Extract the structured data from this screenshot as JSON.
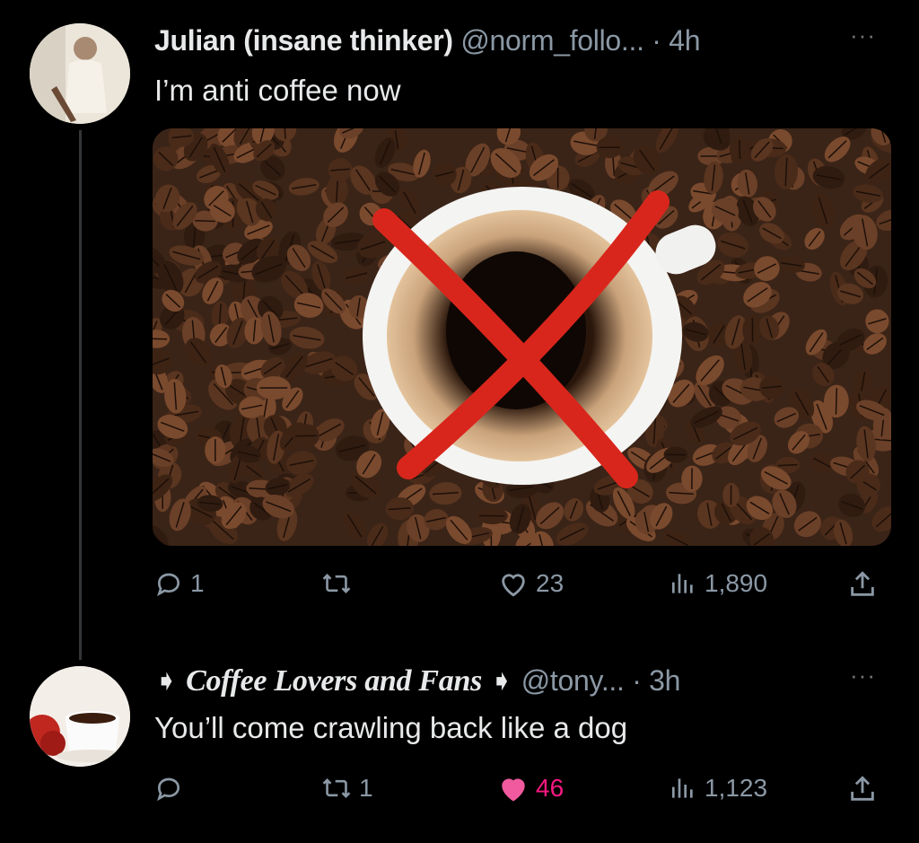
{
  "tweets": [
    {
      "name": "Julian (insane thinker)",
      "handle": "@norm_follo...",
      "separator": " · ",
      "time": "4h",
      "more": "···",
      "text": "I’m anti coffee now",
      "stats": {
        "replies": "1",
        "retweets": "",
        "likes": "23",
        "views": "1,890"
      }
    },
    {
      "name": "Coffee Lovers and Fans",
      "name_prefix": "➧ ",
      "name_suffix": " ➧",
      "handle": "@tony...",
      "separator": " · ",
      "time": "3h",
      "more": "···",
      "text": "You’ll come crawling back like a dog",
      "stats": {
        "replies": "",
        "retweets": "1",
        "likes": "46",
        "views": "1,123"
      }
    }
  ],
  "colors": {
    "background": "#000000",
    "text": "#e7e9ea",
    "muted": "#8b98a5",
    "like": "#f91880",
    "cross": "#d9261c"
  },
  "icons": [
    "reply-icon",
    "retweet-icon",
    "like-icon",
    "views-icon",
    "share-icon",
    "more-icon"
  ]
}
